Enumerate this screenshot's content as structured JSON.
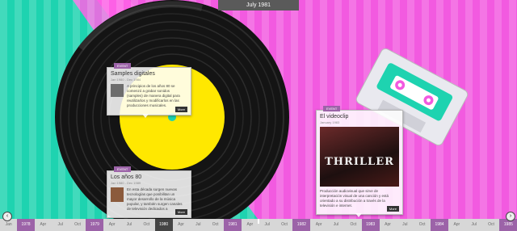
{
  "header": {
    "current_date": "July 1981"
  },
  "nav": {
    "prev_icon": "chevron-left-icon",
    "next_icon": "chevron-right-icon"
  },
  "timeline": {
    "ticks": [
      {
        "label": "Jan"
      },
      {
        "label": "1978",
        "year": true
      },
      {
        "label": "Apr"
      },
      {
        "label": "Jul"
      },
      {
        "label": "Oct"
      },
      {
        "label": "1979",
        "year": true
      },
      {
        "label": "Apr"
      },
      {
        "label": "Jul"
      },
      {
        "label": "Oct"
      },
      {
        "label": "1980",
        "year": true,
        "dark": true
      },
      {
        "label": "Apr"
      },
      {
        "label": "Jul"
      },
      {
        "label": "Oct"
      },
      {
        "label": "1981",
        "year": true
      },
      {
        "label": "Apr"
      },
      {
        "label": "Jul"
      },
      {
        "label": "Oct"
      },
      {
        "label": "1982",
        "year": true
      },
      {
        "label": "Apr"
      },
      {
        "label": "Jul"
      },
      {
        "label": "Oct"
      },
      {
        "label": "1983",
        "year": true
      },
      {
        "label": "Apr"
      },
      {
        "label": "Jul"
      },
      {
        "label": "Oct"
      },
      {
        "label": "1984",
        "year": true
      },
      {
        "label": "Apr"
      },
      {
        "label": "Jul"
      },
      {
        "label": "Oct"
      },
      {
        "label": "1985",
        "year": true
      }
    ]
  },
  "cards": {
    "samples": {
      "tag": "EVENT",
      "title": "Samples digitales",
      "dates": "Jan 1980 - Dec 1984",
      "body": "A principios de los años 80 se comenzó a grabar sonidos (samples) de manera digital para reutilizarlos y modificarlos en las producciones musicales.",
      "more": "More"
    },
    "anos80": {
      "tag": "EVENT",
      "title": "Los años 80",
      "dates": "Jan 1980 - Dec 1989",
      "body": "En esta década surgen nuevas tecnologías que posibilitan un mayor desarrollo de la música popular, y también surgen canales de televisión dedicados a",
      "more": "More"
    },
    "videoclip": {
      "tag": "EVENT",
      "title": "El videoclip",
      "dates": "January 1983",
      "image_text": "THRILLER",
      "body": "Producción audiovisual que sirve de interpretación visual de una canción y está orientado a su distribución a través de la televisión e internet.",
      "more": "More"
    }
  },
  "colors": {
    "teal": "#1ed3b0",
    "pink": "#f25ae0",
    "purple": "#9c63a8",
    "vinyl_label": "#ffe800"
  }
}
